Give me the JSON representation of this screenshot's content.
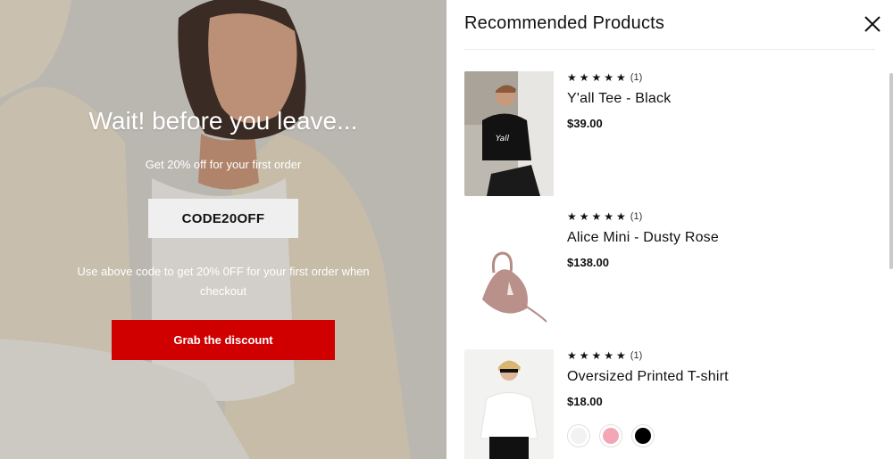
{
  "promo": {
    "title": "Wait! before you leave...",
    "subtitle": "Get 20% off for your first order",
    "code": "CODE20OFF",
    "note": "Use above code to get 20% 0FF for your first order when checkout",
    "cta_label": "Grab the discount",
    "accent_color": "#d10000"
  },
  "panel": {
    "title": "Recommended Products",
    "close_icon": "close-icon"
  },
  "products": [
    {
      "name": "Y'all Tee - Black",
      "price": "$39.00",
      "stars": "★★★★★",
      "rating_count": "(1)"
    },
    {
      "name": "Alice Mini - Dusty Rose",
      "price": "$138.00",
      "stars": "★★★★★",
      "rating_count": "(1)"
    },
    {
      "name": "Oversized Printed T-shirt",
      "price": "$18.00",
      "stars": "★★★★★",
      "rating_count": "(1)",
      "swatches": [
        "#f2f2f2",
        "#f4a6b7",
        "#000000"
      ]
    }
  ]
}
